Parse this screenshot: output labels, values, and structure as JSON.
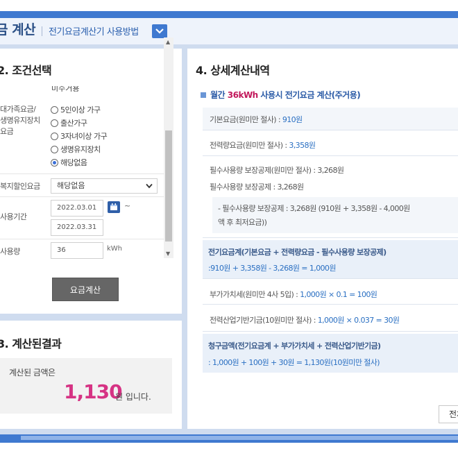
{
  "header": {
    "title": "금 계산",
    "guide_link": "전기요금계산기 사용방법"
  },
  "conditions": {
    "title": "2. 조건선택",
    "top_clipped_option": "미수거용",
    "family_label_lines": [
      "대가족요금/",
      "생명유지장치",
      "요금"
    ],
    "family_options": [
      {
        "label": "5인이상 가구",
        "selected": false
      },
      {
        "label": "출산가구",
        "selected": false
      },
      {
        "label": "3자녀이상 가구",
        "selected": false
      },
      {
        "label": "생명유지장치",
        "selected": false
      },
      {
        "label": "해당없음",
        "selected": true
      }
    ],
    "welfare_label": "복지할인요금",
    "welfare_value": "해당없음",
    "period_label": "사용기간",
    "period_start": "2022.03.01",
    "period_end": "2022.03.31",
    "tilde": "~",
    "usage_label": "사용량",
    "usage_value": "36",
    "usage_unit": "kWh",
    "calc_button": "요금계산"
  },
  "result": {
    "title": "3. 계산된결과",
    "label": "계산된 금액은",
    "amount": "1,130",
    "unit_suffix": "원 입니다."
  },
  "details": {
    "title": "4. 상세계산내역",
    "subhead_pre": "월간 ",
    "subhead_kwh": "36kWh",
    "subhead_post": " 사용시 전기요금 계산(주거용)",
    "rows": {
      "base_label": "기본요금(원미만 절사) : ",
      "base_value": "910원",
      "energy_label": "전력량요금(원미만 절사) : ",
      "energy_value": "3,358원",
      "deduct1": "필수사용량 보장공제(원미만 절사) : 3,268원",
      "deduct2": "필수사용량 보장공제 : 3,268원",
      "deduct_note1": "- 필수사용량 보장공제 : 3,268원 (910원 + 3,358원 - 4,000원",
      "deduct_note2": "액 후 최저요금))",
      "total_head": "전기요금계(기본요금 + 전력량요금 - 필수사용량 보장공제)",
      "total_calc": ":910원 + 3,358원 - 3,268원 = 1,000원",
      "vat_label": "부가가치세(원미만 4사 5입) : ",
      "vat_value": "1,000원 × 0.1 = 100원",
      "fund_label": "전력산업기반기금(10원미만 절사) : ",
      "fund_value": "1,000원 × 0.037 = 30원",
      "bill_head": "청구금액(전기요금계 + 부가가치세 + 전력산업기반기금)",
      "bill_calc": ": 1,000원 + 100원 + 30원 = 1,130원(10원미만 절사)"
    },
    "side_button": "전체"
  },
  "colors": {
    "primary": "#3f79d0",
    "accent_pink": "#d63384",
    "link_blue": "#2a6fc2"
  }
}
